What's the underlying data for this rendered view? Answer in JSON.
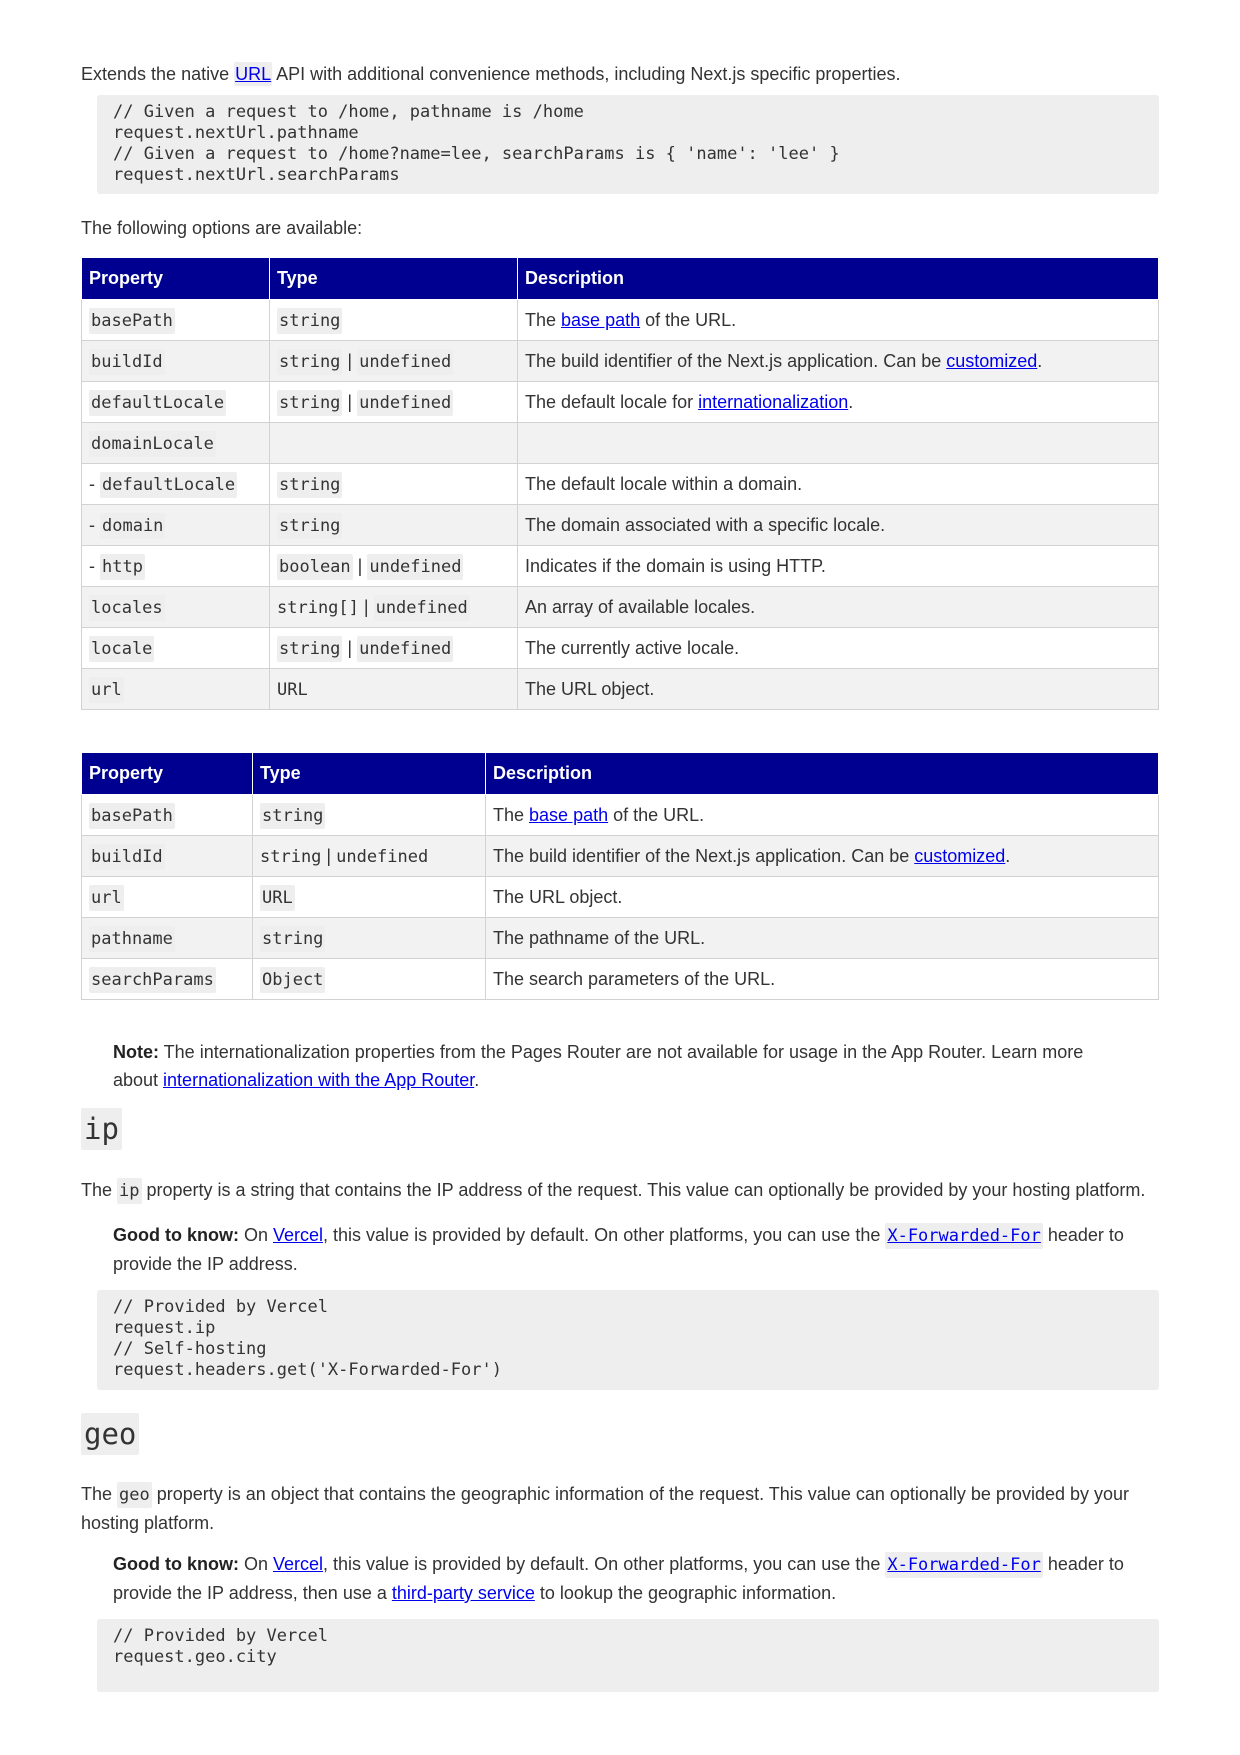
{
  "intro": {
    "pre": "Extends the native ",
    "link": "URL",
    "post": " API with additional convenience methods, including Next.js specific properties."
  },
  "code1": "// Given a request to /home, pathname is /home\nrequest.nextUrl.pathname\n// Given a request to /home?name=lee, searchParams is { 'name': 'lee' }\nrequest.nextUrl.searchParams",
  "options_text": "The following options are available:",
  "table1": {
    "headers": [
      "Property",
      "Type",
      "Description"
    ],
    "rows": [
      {
        "prefix": "",
        "prop": "basePath",
        "types": [
          "string"
        ],
        "desc_pre": "The ",
        "desc_link": "base path",
        "desc_post": " of the URL."
      },
      {
        "prefix": "",
        "prop": "buildId",
        "types": [
          "string",
          "undefined"
        ],
        "desc_pre": "The build identifier of the Next.js application. Can be ",
        "desc_link": "customized",
        "desc_post": "."
      },
      {
        "prefix": "",
        "prop": "defaultLocale",
        "types": [
          "string",
          "undefined"
        ],
        "desc_pre": "The default locale for ",
        "desc_link": "internationalization",
        "desc_post": "."
      },
      {
        "prefix": "",
        "prop": "domainLocale",
        "types": [],
        "desc_pre": "",
        "desc_link": "",
        "desc_post": ""
      },
      {
        "prefix": "- ",
        "prop": "defaultLocale",
        "types": [
          "string"
        ],
        "desc_pre": "The default locale within a domain.",
        "desc_link": "",
        "desc_post": ""
      },
      {
        "prefix": "- ",
        "prop": "domain",
        "types": [
          "string"
        ],
        "desc_pre": "The domain associated with a specific locale.",
        "desc_link": "",
        "desc_post": ""
      },
      {
        "prefix": "- ",
        "prop": "http",
        "types": [
          "boolean",
          "undefined"
        ],
        "desc_pre": "Indicates if the domain is using HTTP.",
        "desc_link": "",
        "desc_post": ""
      },
      {
        "prefix": "",
        "prop": "locales",
        "types": [
          "string[]",
          "undefined"
        ],
        "desc_pre": "An array of available locales.",
        "desc_link": "",
        "desc_post": ""
      },
      {
        "prefix": "",
        "prop": "locale",
        "types": [
          "string",
          "undefined"
        ],
        "desc_pre": "The currently active locale.",
        "desc_link": "",
        "desc_post": ""
      },
      {
        "prefix": "",
        "prop": "url",
        "types": [
          "URL"
        ],
        "desc_pre": "The URL object.",
        "desc_link": "",
        "desc_post": ""
      }
    ]
  },
  "table2": {
    "headers": [
      "Property",
      "Type",
      "Description"
    ],
    "rows": [
      {
        "prefix": "",
        "prop": "basePath",
        "types": [
          "string"
        ],
        "desc_pre": "The ",
        "desc_link": "base path",
        "desc_post": " of the URL."
      },
      {
        "prefix": "",
        "prop": "buildId",
        "types": [
          "string",
          "undefined"
        ],
        "desc_pre": "The build identifier of the Next.js application. Can be ",
        "desc_link": "customized",
        "desc_post": "."
      },
      {
        "prefix": "",
        "prop": "url",
        "types": [
          "URL"
        ],
        "desc_pre": "The URL object.",
        "desc_link": "",
        "desc_post": ""
      },
      {
        "prefix": "",
        "prop": "pathname",
        "types": [
          "string"
        ],
        "desc_pre": "The pathname of the URL.",
        "desc_link": "",
        "desc_post": ""
      },
      {
        "prefix": "",
        "prop": "searchParams",
        "types": [
          "Object"
        ],
        "desc_pre": "The search parameters of the URL.",
        "desc_link": "",
        "desc_post": ""
      }
    ]
  },
  "note": {
    "label": "Note:",
    "line1": " The internationalization properties from the Pages Router are not available for usage in the App Router. Learn more",
    "line2_pre": "about ",
    "line2_link": "internationalization with the App Router",
    "line2_post": "."
  },
  "ip": {
    "heading": "ip",
    "p_pre": "The ",
    "p_code": "ip",
    "p_post": " property is a string that contains the IP address of the request. This value can optionally be provided by your hosting platform.",
    "gtk_label": "Good to know:",
    "gtk_pre": " On ",
    "gtk_link": "Vercel",
    "gtk_mid": ", this value is provided by default. On other platforms, you can use the ",
    "gtk_code_link": "X-Forwarded-For",
    "gtk_post": " header to",
    "gtk_line2": "provide the IP address.",
    "code": "// Provided by Vercel\nrequest.ip\n// Self-hosting\nrequest.headers.get('X-Forwarded-For')"
  },
  "geo": {
    "heading": "geo",
    "p_pre": "The ",
    "p_code": "geo",
    "p_post": " property is an object that contains the geographic information of the request. This value can optionally be provided by your",
    "p_line2": "hosting platform.",
    "gtk_label": "Good to know:",
    "gtk_pre": " On ",
    "gtk_link": "Vercel",
    "gtk_mid": ", this value is provided by default. On other platforms, you can use the ",
    "gtk_code_link": "X-Forwarded-For",
    "gtk_post": " header to",
    "gtk_line2_pre": "provide the IP address, then use a ",
    "gtk_line2_link": "third-party service",
    "gtk_line2_post": " to lookup the geographic information.",
    "code": "// Provided by Vercel\nrequest.geo.city"
  }
}
